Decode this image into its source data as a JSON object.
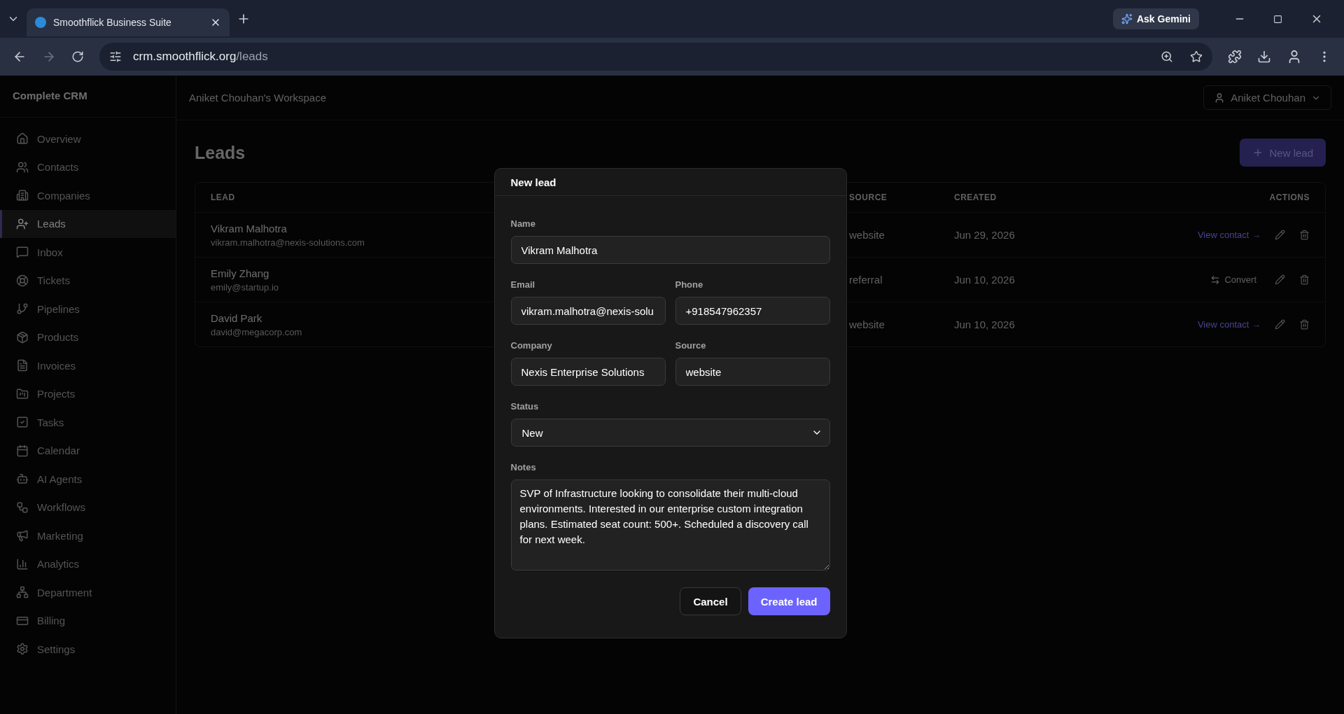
{
  "browser": {
    "tab_title": "Smoothflick Business Suite",
    "url_host": "crm.smoothflick.org",
    "url_path": "/leads",
    "ask_gemini": "Ask Gemini"
  },
  "sidebar": {
    "brand": "Complete CRM",
    "items": [
      {
        "label": "Overview",
        "selected": false
      },
      {
        "label": "Contacts",
        "selected": false
      },
      {
        "label": "Companies",
        "selected": false
      },
      {
        "label": "Leads",
        "selected": true
      },
      {
        "label": "Inbox",
        "selected": false
      },
      {
        "label": "Tickets",
        "selected": false
      },
      {
        "label": "Pipelines",
        "selected": false
      },
      {
        "label": "Products",
        "selected": false
      },
      {
        "label": "Invoices",
        "selected": false
      },
      {
        "label": "Projects",
        "selected": false
      },
      {
        "label": "Tasks",
        "selected": false
      },
      {
        "label": "Calendar",
        "selected": false
      },
      {
        "label": "AI Agents",
        "selected": false
      },
      {
        "label": "Workflows",
        "selected": false
      },
      {
        "label": "Marketing",
        "selected": false
      },
      {
        "label": "Analytics",
        "selected": false
      },
      {
        "label": "Department",
        "selected": false
      },
      {
        "label": "Billing",
        "selected": false
      },
      {
        "label": "Settings",
        "selected": false
      }
    ]
  },
  "header": {
    "workspace": "Aniket Chouhan's Workspace",
    "user": "Aniket Chouhan"
  },
  "page": {
    "title": "Leads",
    "new_button": "New lead"
  },
  "table": {
    "columns": [
      "LEAD",
      "SOURCE",
      "CREATED",
      "ACTIONS"
    ],
    "rows": [
      {
        "name": "Vikram Malhotra",
        "email": "vikram.malhotra@nexis-solutions.com",
        "source": "website",
        "created": "Jun 29, 2026",
        "action": {
          "kind": "link",
          "label": "View contact →"
        }
      },
      {
        "name": "Emily Zhang",
        "email": "emily@startup.io",
        "source": "referral",
        "created": "Jun 10, 2026",
        "action": {
          "kind": "convert",
          "label": "Convert"
        }
      },
      {
        "name": "David Park",
        "email": "david@megacorp.com",
        "source": "website",
        "created": "Jun 10, 2026",
        "action": {
          "kind": "link",
          "label": "View contact →"
        }
      }
    ]
  },
  "modal": {
    "title": "New lead",
    "fields": {
      "name": {
        "label": "Name",
        "value": "Vikram Malhotra"
      },
      "email": {
        "label": "Email",
        "value": "vikram.malhotra@nexis-solu"
      },
      "phone": {
        "label": "Phone",
        "value": "+918547962357"
      },
      "company": {
        "label": "Company",
        "value": "Nexis Enterprise Solutions"
      },
      "source": {
        "label": "Source",
        "value": "website"
      },
      "status": {
        "label": "Status",
        "value": "New"
      },
      "notes": {
        "label": "Notes",
        "value": "SVP of Infrastructure looking to consolidate their multi-cloud environments. Interested in our enterprise custom integration plans. Estimated seat count: 500+. Scheduled a discovery call for next week."
      }
    },
    "cancel": "Cancel",
    "submit": "Create lead"
  }
}
